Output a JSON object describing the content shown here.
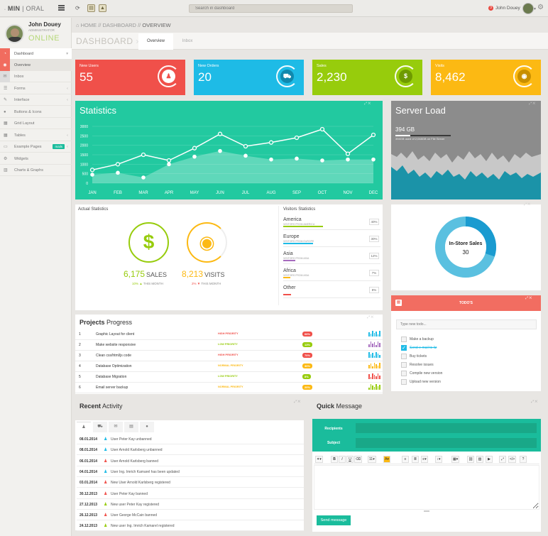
{
  "app": {
    "logo_prefix": "MIN",
    "logo_suffix": "ORAL"
  },
  "topbar": {
    "search_placeholder": "Search in dashboard",
    "user_name": "John Douey",
    "notif_count": "3"
  },
  "sidebar": {
    "user": {
      "name": "John Douey",
      "role": "ADMINISTRATOR",
      "status": "ONLINE"
    },
    "items": [
      {
        "label": "Dashboard",
        "icon": "dashboard-icon"
      },
      {
        "label": "Overview",
        "icon": "eye-icon"
      },
      {
        "label": "Inbox",
        "icon": "envelope-icon"
      },
      {
        "label": "Forms",
        "icon": "list-icon"
      },
      {
        "label": "Interface",
        "icon": "pencil-icon"
      },
      {
        "label": "Buttons & Icons",
        "icon": "bulb-icon"
      },
      {
        "label": "Grid Layout",
        "icon": "grid-icon"
      },
      {
        "label": "Tables",
        "icon": "table-icon"
      },
      {
        "label": "Example Pages",
        "icon": "desktop-icon",
        "badge": "mails"
      },
      {
        "label": "Widgets",
        "icon": "gear-icon"
      },
      {
        "label": "Charts & Graphs",
        "icon": "chart-icon"
      }
    ]
  },
  "breadcrumb": {
    "home": "HOME",
    "dashboard": "DASHBOARD",
    "current": "OVERVIEW"
  },
  "page": {
    "title": "DASHBOARD",
    "tabs": [
      "Overview",
      "Inbox"
    ]
  },
  "tiles": [
    {
      "label": "New Users",
      "value": "55",
      "color": "#f0504a",
      "icon": "user-icon"
    },
    {
      "label": "New Orders",
      "value": "20",
      "color": "#1ebbe6",
      "icon": "cart-icon"
    },
    {
      "label": "Sales",
      "value": "2,230",
      "color": "#97cc0c",
      "icon": "dollar-icon"
    },
    {
      "label": "Visits",
      "value": "8,462",
      "color": "#fcb913",
      "icon": "eye-icon"
    }
  ],
  "statistics": {
    "title": "Statistics"
  },
  "chart_data": {
    "type": "line",
    "categories": [
      "JAN",
      "FEB",
      "MAR",
      "APR",
      "MAY",
      "JUN",
      "JUL",
      "AUG",
      "SEP",
      "OCT",
      "NOV",
      "DEC"
    ],
    "yticks": [
      "3000",
      "2500",
      "2000",
      "1500",
      "1000",
      "500",
      "0"
    ],
    "ylim": [
      0,
      3000
    ],
    "series": [
      {
        "values": [
          700,
          1000,
          1500,
          1200,
          1850,
          2600,
          1950,
          2150,
          2400,
          2850,
          1550,
          2550
        ]
      },
      {
        "values": [
          450,
          550,
          300,
          1000,
          1400,
          1700,
          1450,
          1250,
          1300,
          1200,
          1250,
          1250
        ]
      }
    ]
  },
  "server": {
    "title": "Server Load",
    "value": "394 GB",
    "sub": "394GB used of 2,048GB on File Server"
  },
  "actual": {
    "title": "Actual Statistics",
    "sales_value": "6,175",
    "sales_label": "SALES",
    "sales_change": "10%",
    "sales_period": "THIS MONTH",
    "visits_value": "8,213",
    "visits_label": "VISITS",
    "visits_change": "2%",
    "visits_period": "THIS MONTH"
  },
  "visitors": {
    "title": "Visitors Statistics",
    "rows": [
      {
        "name": "America",
        "sub": "VISITORS FROM AMERICA",
        "pct": "40%",
        "frac": 0.4,
        "color": "#97cc0c"
      },
      {
        "name": "Europe",
        "sub": "VISITORS FROM EUROPE",
        "pct": "30%",
        "frac": 0.3,
        "color": "#1ebbe6"
      },
      {
        "name": "Asia",
        "sub": "VISITORS FROM ASIA",
        "pct": "12%",
        "frac": 0.12,
        "color": "#a66bbe"
      },
      {
        "name": "Africa",
        "sub": "VISITORS FROM ASIA",
        "pct": "7%",
        "frac": 0.07,
        "color": "#fcb913"
      },
      {
        "name": "Other",
        "sub": "",
        "pct": "8%",
        "frac": 0.08,
        "color": "#f0504a"
      }
    ]
  },
  "donut": {
    "title": "In-Store Sales",
    "value": "30",
    "fraction": 0.3
  },
  "todo": {
    "title": "TODO'S",
    "placeholder": "Type new todo...",
    "items": [
      {
        "text": "Make a backup",
        "done": false
      },
      {
        "text": "Send e-mail to liz",
        "done": true
      },
      {
        "text": "Buy tickets",
        "done": false
      },
      {
        "text": "Resolve issues",
        "done": false
      },
      {
        "text": "Compile new version",
        "done": false
      },
      {
        "text": "Upload new version",
        "done": false
      }
    ]
  },
  "projects": {
    "title_bold": "Projects",
    "title_rest": "Progress",
    "rows": [
      {
        "n": "1",
        "name": "Graphic Layout for client",
        "priority": "HIGH PRIORITY",
        "pcolor": "#f0504a",
        "pct": "66%",
        "bar": "#1ebbe6"
      },
      {
        "n": "2",
        "name": "Make website responsive",
        "priority": "LOW PRIORITY",
        "pcolor": "#97cc0c",
        "pct": "13%",
        "bar": "#a66bbe"
      },
      {
        "n": "3",
        "name": "Clean css/html/js code",
        "priority": "HIGH PRIORITY",
        "pcolor": "#f0504a",
        "pct": "70%",
        "bar": "#1ebbe6"
      },
      {
        "n": "4",
        "name": "Database Optimization",
        "priority": "NORMAL PRIORITY",
        "pcolor": "#fcb913",
        "pct": "30%",
        "bar": "#fcb913"
      },
      {
        "n": "5",
        "name": "Database Migration",
        "priority": "LOW PRIORITY",
        "pcolor": "#97cc0c",
        "pct": "8%",
        "bar": "#f0504a"
      },
      {
        "n": "6",
        "name": "Email server backup",
        "priority": "NORMAL PRIORITY",
        "pcolor": "#fcb913",
        "pct": "20%",
        "bar": "#97cc0c"
      }
    ]
  },
  "recent": {
    "title_bold": "Recent",
    "title_rest": "Activity",
    "tabs": [
      "users-icon",
      "cart-icon",
      "envelope-icon",
      "card-icon",
      "chat-icon"
    ],
    "rows": [
      {
        "date": "08.01.2014",
        "text": "User Peter Kay unbanned",
        "icolor": "#1ebbe6"
      },
      {
        "date": "08.01.2014",
        "text": "User Arnold Karlsberg unbanned",
        "icolor": "#1ebbe6"
      },
      {
        "date": "06.01.2014",
        "text": "User Arnold Karlsberg banned",
        "icolor": "#f0504a"
      },
      {
        "date": "04.01.2014",
        "text": "User Ing. Imrich Kamarel has been updated",
        "icolor": "#1ebbe6"
      },
      {
        "date": "03.01.2014",
        "text": "New User Arnold Karlsberg registered",
        "icolor": "#f0504a"
      },
      {
        "date": "30.12.2013",
        "text": "User Peter Kay banned",
        "icolor": "#f0504a"
      },
      {
        "date": "27.12.2013",
        "text": "New user Peter Kay registered",
        "icolor": "#97cc0c"
      },
      {
        "date": "26.12.2013",
        "text": "User George McCain banned",
        "icolor": "#f0504a"
      },
      {
        "date": "24.12.2013",
        "text": "New user Ing. Imrich Kamarel registered",
        "icolor": "#97cc0c"
      }
    ]
  },
  "quick": {
    "title_bold": "Quick",
    "title_rest": "Message",
    "recipients_label": "Recipients",
    "subject_label": "Subject",
    "send_label": "Send message"
  }
}
